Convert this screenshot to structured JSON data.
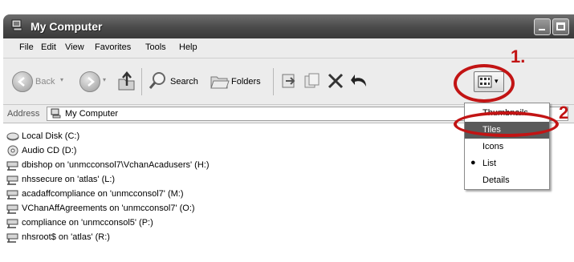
{
  "window": {
    "title": "My Computer"
  },
  "menubar": {
    "items": [
      "File",
      "Edit",
      "View",
      "Favorites",
      "Tools",
      "Help"
    ]
  },
  "toolbar": {
    "back_label": "Back",
    "search_label": "Search",
    "folders_label": "Folders"
  },
  "address": {
    "label": "Address",
    "value": "My Computer"
  },
  "files": [
    {
      "name": "Local Disk (C:)",
      "icon": "hard-disk-icon"
    },
    {
      "name": "Audio CD (D:)",
      "icon": "cd-drive-icon"
    },
    {
      "name": "dbishop on 'unmcconsol7\\VchanAcadusers' (H:)",
      "icon": "network-drive-icon"
    },
    {
      "name": "nhssecure on 'atlas' (L:)",
      "icon": "network-drive-icon"
    },
    {
      "name": "acadaffcompliance on 'unmcconsol7' (M:)",
      "icon": "network-drive-icon"
    },
    {
      "name": "VChanAffAgreements on 'unmcconsol7' (O:)",
      "icon": "network-drive-icon"
    },
    {
      "name": "compliance on 'unmcconsol5' (P:)",
      "icon": "network-drive-icon"
    },
    {
      "name": "nhsroot$ on 'atlas' (R:)",
      "icon": "network-drive-icon"
    }
  ],
  "views_menu": {
    "items": [
      "Thumbnails",
      "Tiles",
      "Icons",
      "List",
      "Details"
    ],
    "highlighted": "Tiles",
    "checked": "List"
  },
  "annotations": {
    "step1": "1.",
    "step2": "2"
  }
}
